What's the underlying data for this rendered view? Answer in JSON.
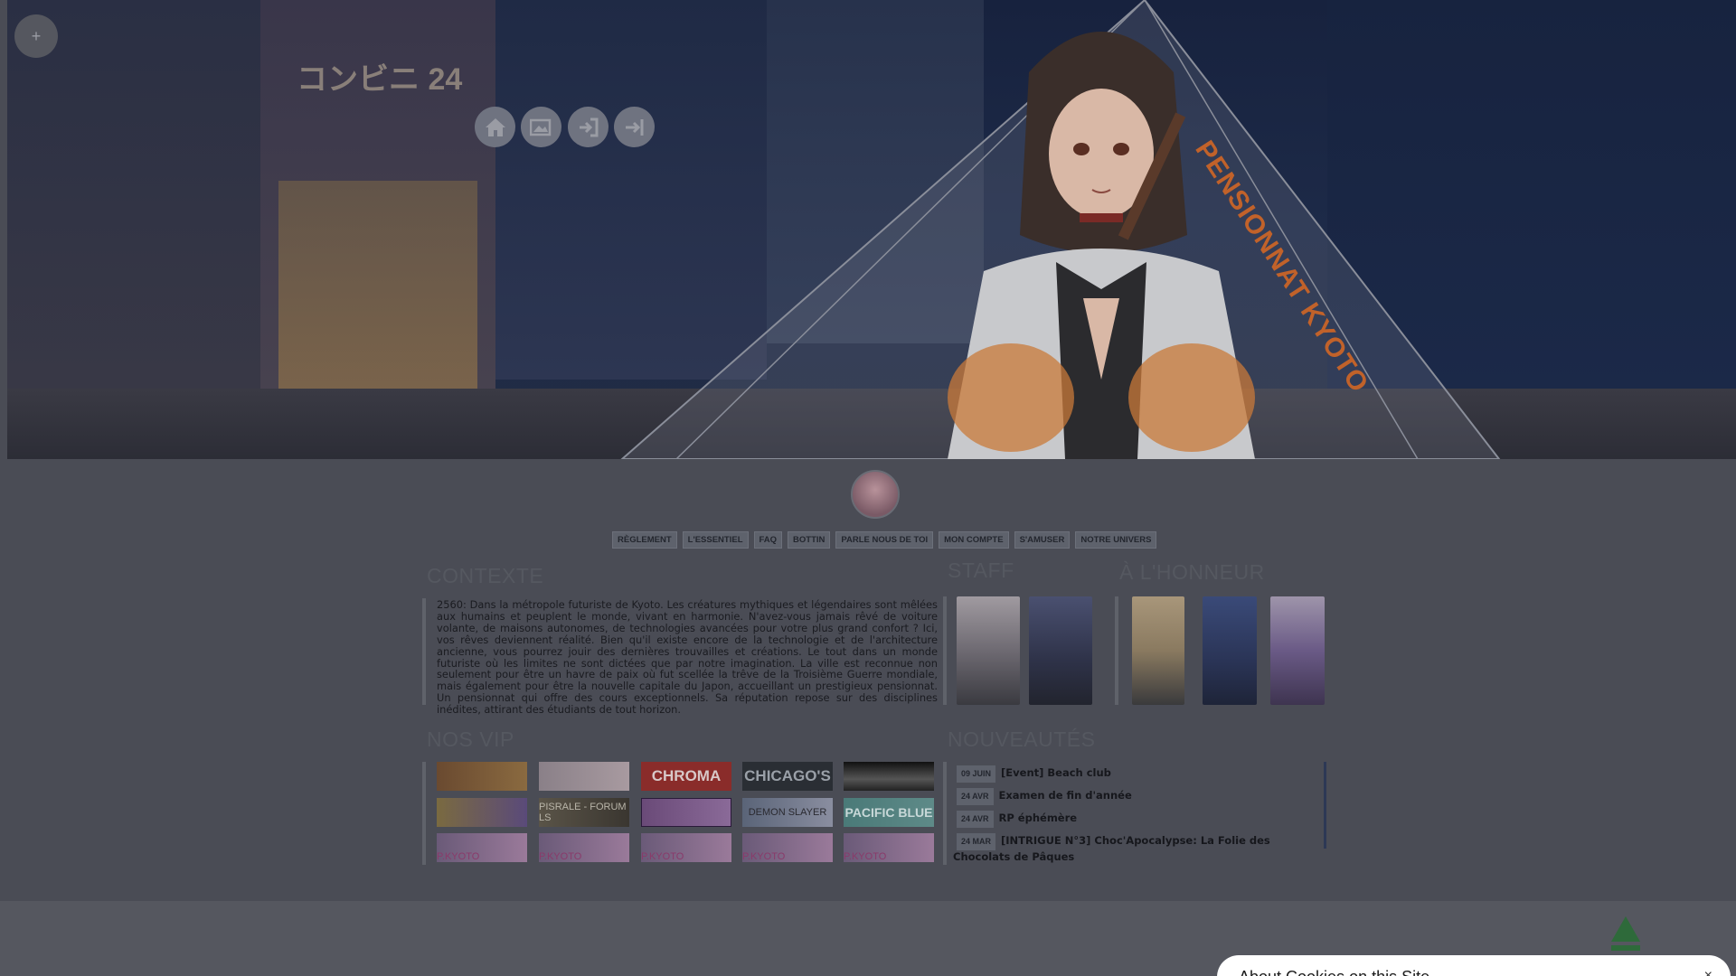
{
  "header": {
    "title": "PENSIONNAT KYOTO",
    "plus_label": "+",
    "nav_icons": [
      "home-icon",
      "gallery-icon",
      "login-icon",
      "register-icon"
    ]
  },
  "menu": {
    "items": [
      "RÈGLEMENT",
      "L'ESSENTIEL",
      "FAQ",
      "BOTTIN",
      "PARLE NOUS DE TOI",
      "MON COMPTE",
      "S'AMUSER",
      "NOTRE UNIVERS"
    ]
  },
  "contexte": {
    "title": "CONTEXTE",
    "text": "2560: Dans la métropole futuriste de Kyoto. Les créatures mythiques et légendaires sont mêlées aux humains et peuplent le monde, vivant en harmonie. N'avez-vous jamais rêvé de voiture volante, de maisons autonomes, de technologies avancées pour votre plus grand confort ? Ici, vos rêves deviennent réalité. Bien qu'il existe encore de la technologie et de l'architecture ancienne, vous pourrez jouir des dernières trouvailles et créations. Le tout dans un monde futuriste où les limites ne sont dictées que par notre imagination. La ville est reconnue non seulement pour être un havre de paix où fut scellée la trêve de la Troisième Guerre mondiale, mais également pour être la nouvelle capitale du Japon, accueillant un prestigieux pensionnat. Un pensionnat qui offre des cours exceptionnels. Sa réputation repose sur des disciplines inédites, attirant des étudiants de tout horizon."
  },
  "staff": {
    "title": "STAFF"
  },
  "honneur": {
    "title": "À L'HONNEUR"
  },
  "vip": {
    "title": "NOS VIP",
    "row1": [
      "",
      "",
      "CHROMA",
      "CHICAGO'S",
      ""
    ],
    "row2": [
      "",
      "PISRALE - FORUM LS",
      "",
      "DEMON SLAYER",
      "PACIFIC BLUE"
    ],
    "row3": [
      "P.KYOTO",
      "P.KYOTO",
      "P.KYOTO",
      "P.KYOTO",
      "P.KYOTO"
    ]
  },
  "nouveautes": {
    "title": "NOUVEAUTÉS",
    "items": [
      {
        "date": "09 JUIN",
        "text": "[Event] Beach club"
      },
      {
        "date": "24 AVR",
        "text": "Examen de fin d'année"
      },
      {
        "date": "24 AVR",
        "text": "RP éphémère"
      },
      {
        "date": "24 MAR",
        "text": "[INTRIGUE N°3] Choc'Apocalypse: La Folie des Chocolats de Pâques"
      }
    ]
  },
  "cookie": {
    "title": "About Cookies on this Site",
    "close_label": "×"
  },
  "colors": {
    "accent_orange": "#c1622a",
    "overlay": "#4a4c55"
  }
}
